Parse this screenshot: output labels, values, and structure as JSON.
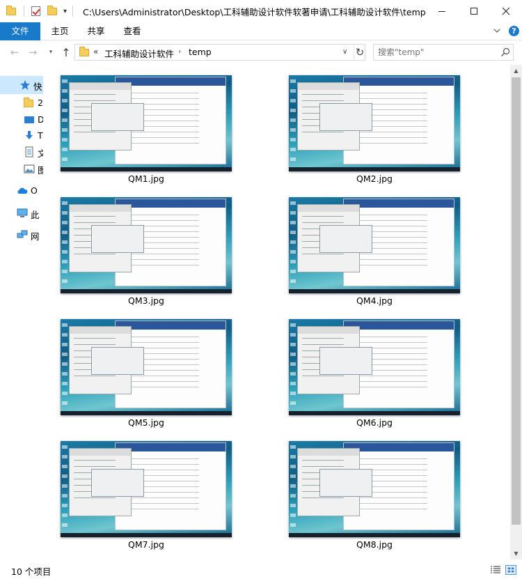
{
  "window": {
    "title": "C:\\Users\\Administrator\\Desktop\\工科辅助设计软件软著申请\\工科辅助设计软件\\temp"
  },
  "ribbon": {
    "tabs": [
      "文件",
      "主页",
      "共享",
      "查看"
    ],
    "help": "?"
  },
  "address": {
    "overflow": "«",
    "segments": [
      "工科辅助设计软件",
      "temp"
    ],
    "separator": "›"
  },
  "search": {
    "placeholder": "搜索\"temp\""
  },
  "nav_pane": {
    "items": [
      {
        "label": "快",
        "icon": "star-icon"
      },
      {
        "label": "2",
        "icon": "folder-icon"
      },
      {
        "label": "D",
        "icon": "desktop-icon"
      },
      {
        "label": "T",
        "icon": "download-icon"
      },
      {
        "label": "文",
        "icon": "document-icon"
      },
      {
        "label": "图",
        "icon": "picture-icon"
      },
      {
        "label": "O",
        "icon": "cloud-icon"
      },
      {
        "label": "此",
        "icon": "computer-icon"
      },
      {
        "label": "网",
        "icon": "network-icon"
      }
    ]
  },
  "files": [
    {
      "name": "QM1.jpg"
    },
    {
      "name": "QM2.jpg"
    },
    {
      "name": "QM3.jpg"
    },
    {
      "name": "QM4.jpg"
    },
    {
      "name": "QM5.jpg"
    },
    {
      "name": "QM6.jpg"
    },
    {
      "name": "QM7.jpg"
    },
    {
      "name": "QM8.jpg"
    }
  ],
  "status": {
    "item_count": "10 个项目"
  },
  "colors": {
    "accent": "#1979ca",
    "selection": "#cce8ff",
    "folder": "#f5cd5c"
  }
}
